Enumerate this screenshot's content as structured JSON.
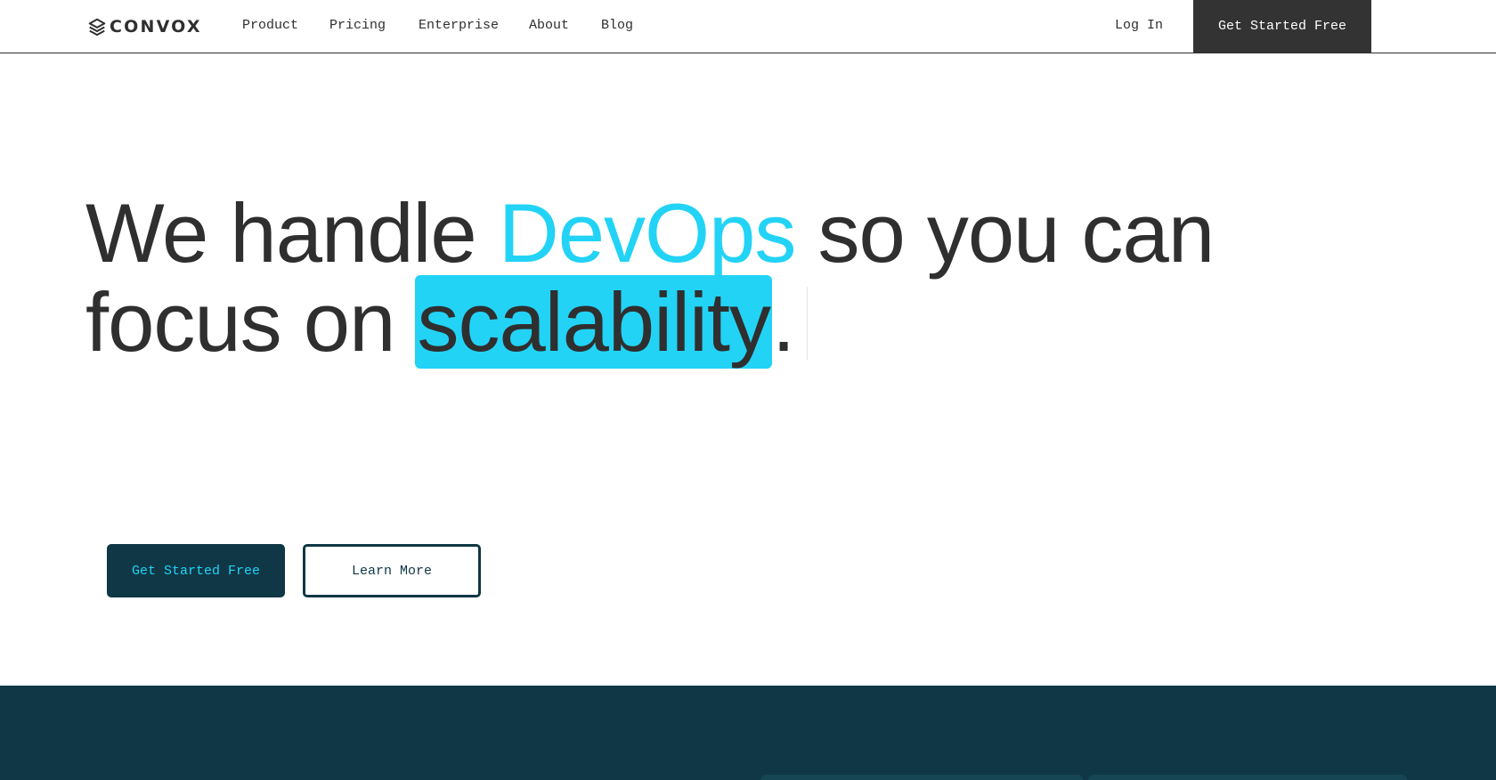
{
  "brand": {
    "name": "CONVOX",
    "logo_icon": "stack-layers-icon"
  },
  "nav": {
    "items": [
      {
        "label": "Product"
      },
      {
        "label": "Pricing"
      },
      {
        "label": "Enterprise"
      },
      {
        "label": "About"
      },
      {
        "label": "Blog"
      }
    ],
    "login_label": "Log In",
    "cta_label": "Get Started Free"
  },
  "hero": {
    "line1_a": "We handle ",
    "line1_accent": "DevOps",
    "line1_b": " so you can",
    "line2_a": "focus on ",
    "line2_highlight": "scalability",
    "line2_end": "."
  },
  "actions": {
    "primary_label": "Get Started Free",
    "secondary_label": "Learn More"
  },
  "colors": {
    "accent": "#22d3f6",
    "dark_teal": "#0f3745",
    "text": "#2f2f2f",
    "nav_cta_bg": "#333333"
  }
}
